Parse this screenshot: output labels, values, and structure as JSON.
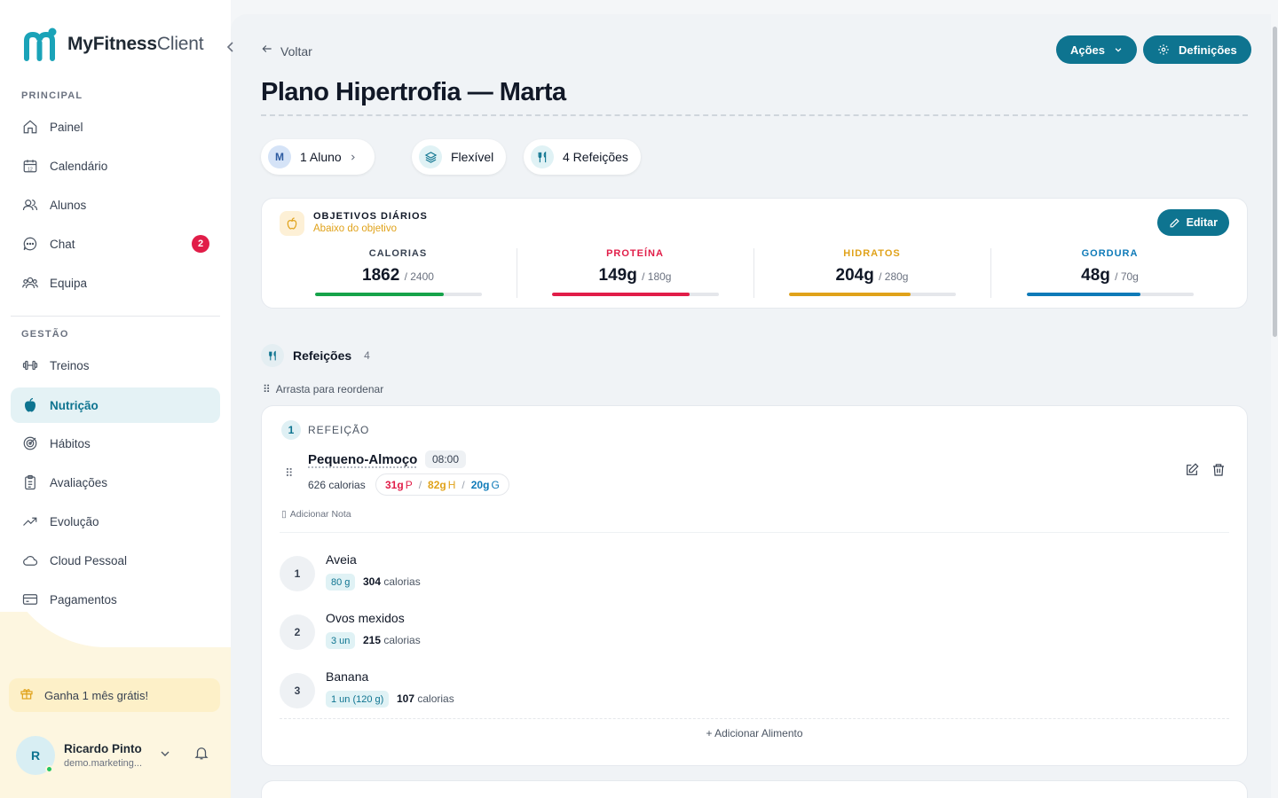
{
  "app": {
    "logo_bold": "MyFitness",
    "logo_light": "Client"
  },
  "sidebar": {
    "section_main": "PRINCIPAL",
    "section_manage": "GESTÃO",
    "main_items": [
      {
        "label": "Painel",
        "icon": "home-icon"
      },
      {
        "label": "Calendário",
        "icon": "calendar-icon"
      },
      {
        "label": "Alunos",
        "icon": "users-icon"
      },
      {
        "label": "Chat",
        "icon": "chat-icon",
        "badge": "2"
      },
      {
        "label": "Equipa",
        "icon": "team-icon"
      }
    ],
    "manage_items": [
      {
        "label": "Treinos",
        "icon": "dumbbell-icon"
      },
      {
        "label": "Nutrição",
        "icon": "apple-icon",
        "active": true
      },
      {
        "label": "Hábitos",
        "icon": "target-icon"
      },
      {
        "label": "Avaliações",
        "icon": "clipboard-icon"
      },
      {
        "label": "Evolução",
        "icon": "trend-icon"
      },
      {
        "label": "Cloud Pessoal",
        "icon": "cloud-icon"
      },
      {
        "label": "Pagamentos",
        "icon": "card-icon"
      }
    ],
    "promo": "Ganha 1 mês grátis!",
    "user": {
      "initial": "R",
      "name": "Ricardo Pinto",
      "email": "demo.marketing..."
    }
  },
  "header": {
    "back": "Voltar",
    "actions_label": "Ações",
    "settings_label": "Definições",
    "title": "Plano Hipertrofia — Marta"
  },
  "pills": {
    "student_initial": "M",
    "students": "1 Aluno",
    "type": "Flexível",
    "meals": "4 Refeições"
  },
  "objectives": {
    "title": "OBJETIVOS DIÁRIOS",
    "subtitle": "Abaixo do objetivo",
    "edit_label": "Editar",
    "metrics": [
      {
        "name": "CALORIAS",
        "value": "1862",
        "target": "/ 2400",
        "progress": 0.776,
        "color": "#16a34a",
        "name_color": "#374151"
      },
      {
        "name": "PROTEÍNA",
        "value": "149g",
        "target": "/ 180g",
        "progress": 0.828,
        "color": "#e11d48",
        "name_color": "#e11d48"
      },
      {
        "name": "HIDRATOS",
        "value": "204g",
        "target": "/ 280g",
        "progress": 0.729,
        "color": "#e0a21a",
        "name_color": "#e0a21a"
      },
      {
        "name": "GORDURA",
        "value": "48g",
        "target": "/ 70g",
        "progress": 0.686,
        "color": "#0e7ab8",
        "name_color": "#0e7ab8"
      }
    ]
  },
  "meals_section": {
    "title": "Refeições",
    "count": "4",
    "drag_hint": "Arrasta para reordenar"
  },
  "meal": {
    "number": "1",
    "label": "REFEIÇÃO",
    "name": "Pequeno-Almoço",
    "time": "08:00",
    "calories": "626 calorias",
    "protein": "31g",
    "protein_unit": "P",
    "carbs": "82g",
    "carbs_unit": "H",
    "fat": "20g",
    "fat_unit": "G",
    "note_label": "Adicionar Nota",
    "foods": [
      {
        "num": "1",
        "name": "Aveia",
        "qty": "80 g",
        "kcal": "304",
        "kcal_unit": "calorias"
      },
      {
        "num": "2",
        "name": "Ovos mexidos",
        "qty": "3 un",
        "kcal": "215",
        "kcal_unit": "calorias"
      },
      {
        "num": "3",
        "name": "Banana",
        "qty": "1 un (120 g)",
        "kcal": "107",
        "kcal_unit": "calorias"
      }
    ],
    "add_food": "+ Adicionar Alimento"
  }
}
